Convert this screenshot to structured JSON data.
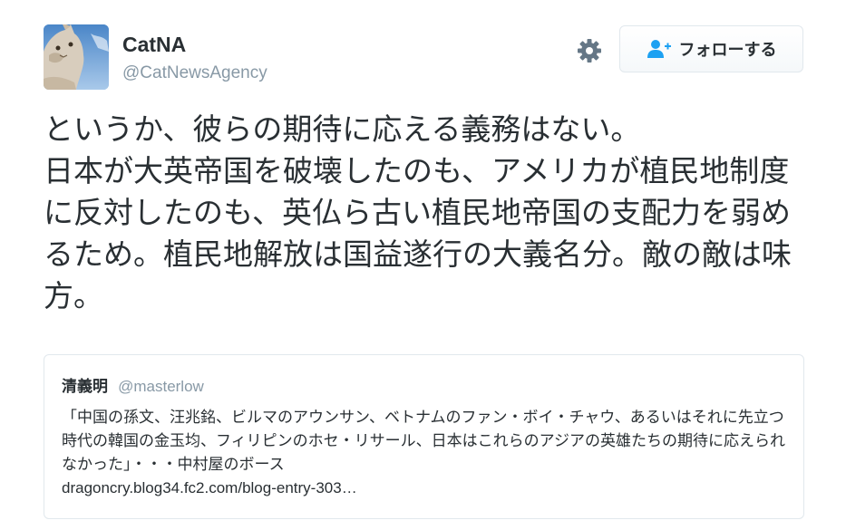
{
  "author": {
    "display_name": "CatNA",
    "screen_name": "@CatNewsAgency",
    "avatar_icon": "cat-photo-avatar"
  },
  "actions": {
    "settings_icon": "gear-icon",
    "follow_icon": "add-user-icon",
    "follow_label": "フォローする"
  },
  "tweet": {
    "text": "というか、彼らの期待に応える義務はない。\n日本が大英帝国を破壊したのも、アメリカが植民地制度に反対したのも、英仏ら古い植民地帝国の支配力を弱めるため。植民地解放は国益遂行の大義名分。敵の敵は味方。"
  },
  "quoted": {
    "name": "清義明",
    "handle": "@masterlow",
    "text": "「中国の孫文、汪兆銘、ビルマのアウンサン、ベトナムのファン・ボイ・チャウ、あるいはそれに先立つ時代の韓国の金玉均、フィリピンのホセ・リサール、日本はこれらのアジアの英雄たちの期待に応えられなかった」・・・中村屋のボース",
    "link": "dragoncry.blog34.fc2.com/blog-entry-303…"
  },
  "colors": {
    "text": "#292f33",
    "muted": "#8899a6",
    "border": "#e1e8ed",
    "icon": "#657786",
    "follow_icon": "#1da1f2"
  }
}
